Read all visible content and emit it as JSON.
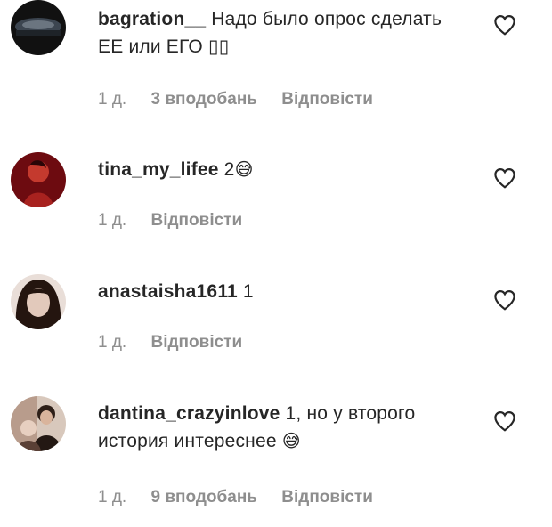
{
  "comments": [
    {
      "username": "bagration__",
      "text": "Надо было опрос сделать ЕЕ или ЕГО",
      "trailing": "▯▯",
      "time": "1 д.",
      "likes": "3 вподобань",
      "reply": "Відповісти",
      "avatar_colors": [
        "#1b1b1b",
        "#4b5560"
      ]
    },
    {
      "username": "tina_my_lifee",
      "text": "2",
      "trailing": "😅",
      "time": "1 д.",
      "likes": "",
      "reply": "Відповісти",
      "avatar_colors": [
        "#7a0d12",
        "#c23a2d"
      ]
    },
    {
      "username": "anastaisha1611",
      "text": "1",
      "trailing": "",
      "time": "1 д.",
      "likes": "",
      "reply": "Відповісти",
      "avatar_colors": [
        "#2a1d18",
        "#d9c7bc"
      ]
    },
    {
      "username": "dantina_crazyinlove",
      "text": "1, но у второго история интереснее",
      "trailing": "😅",
      "time": "1 д.",
      "likes": "9 вподобань",
      "reply": "Відповісти",
      "avatar_colors": [
        "#3a2a22",
        "#c8a894"
      ]
    }
  ],
  "icons": {
    "like": "heart-outline-icon"
  },
  "colors": {
    "text": "#262626",
    "muted": "#8e8e8e"
  }
}
